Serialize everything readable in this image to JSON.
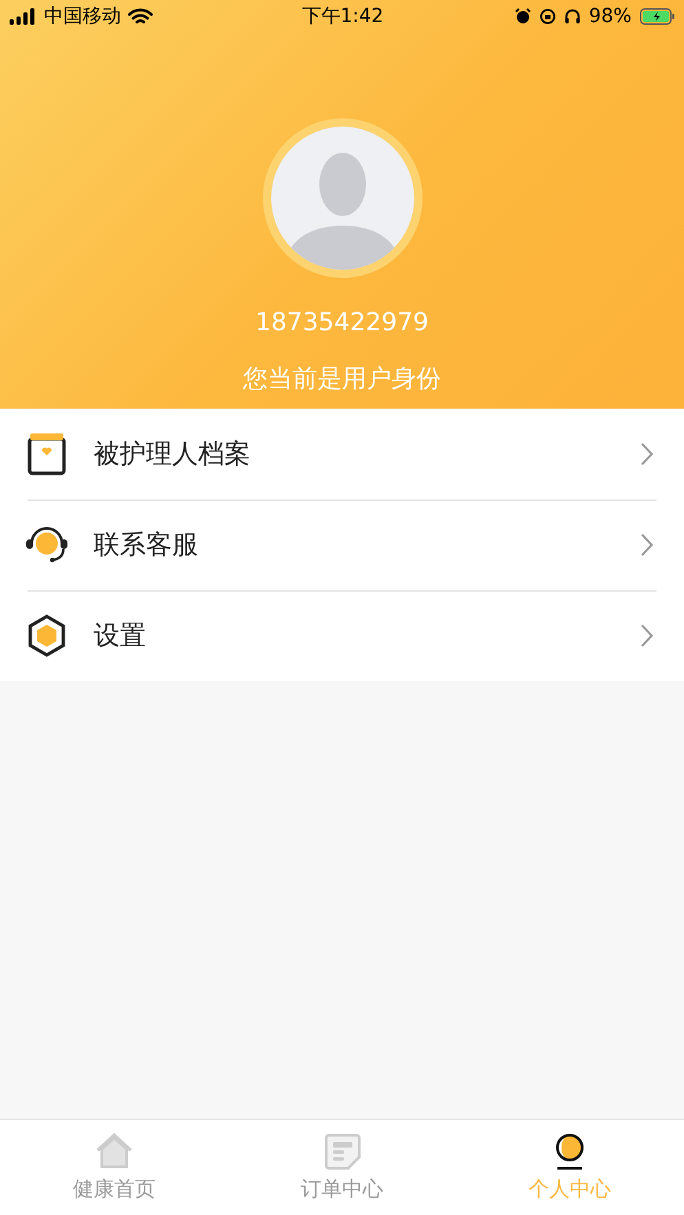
{
  "status_bar": {
    "carrier": "中国移动",
    "time": "下午1:42",
    "battery": "98%"
  },
  "profile": {
    "phone": "18735422979",
    "role": "您当前是用户身份"
  },
  "menu": [
    {
      "kind": "archive",
      "label": "被护理人档案"
    },
    {
      "kind": "service",
      "label": "联系客服"
    },
    {
      "kind": "settings",
      "label": "设置"
    }
  ],
  "tabs": [
    {
      "kind": "home",
      "label": "健康首页",
      "selected": false
    },
    {
      "kind": "orders",
      "label": "订单中心",
      "selected": false
    },
    {
      "kind": "profile",
      "label": "个人中心",
      "selected": true
    }
  ]
}
